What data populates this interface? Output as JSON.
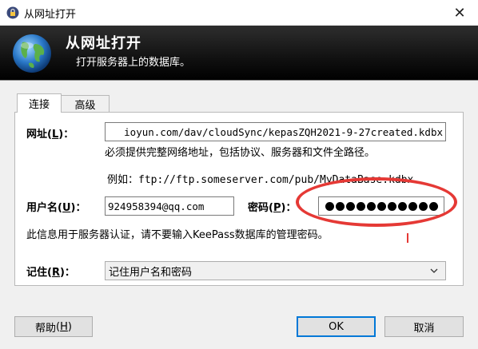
{
  "window": {
    "title": "从网址打开"
  },
  "banner": {
    "title": "从网址打开",
    "subtitle": "打开服务器上的数据库。"
  },
  "tabs": [
    {
      "label": "连接",
      "active": true
    },
    {
      "label": "高级",
      "active": false
    }
  ],
  "url": {
    "label": "网址",
    "hotkey": "L",
    "value": "ioyun.com/dav/cloudSync/kepasZQH2021-9-27created.kdbx",
    "hint": "必须提供完整网络地址，包括协议、服务器和文件全路径。",
    "example_prefix": "例如：",
    "example_value": "ftp://ftp.someserver.com/pub/MyDataBase.kdbx"
  },
  "username": {
    "label": "用户名",
    "hotkey": "U",
    "value": "924958394@qq.com"
  },
  "password": {
    "label": "密码",
    "hotkey": "P",
    "masked_count": 11
  },
  "auth_note": "此信息用于服务器认证，请不要输入KeePass数据库的管理密码。",
  "remember": {
    "label": "记住",
    "hotkey": "R",
    "selected": "记住用户名和密码"
  },
  "buttons": {
    "help": {
      "label": "帮助",
      "hotkey": "H"
    },
    "ok": "OK",
    "cancel": "取消"
  },
  "colors": {
    "annotation": "#e53935",
    "focus": "#0078d7",
    "banner": "#111111"
  },
  "icons": {
    "title": "lock-icon",
    "banner": "globe-icon",
    "close": "close-icon",
    "dropdown": "chevron-down-icon"
  }
}
